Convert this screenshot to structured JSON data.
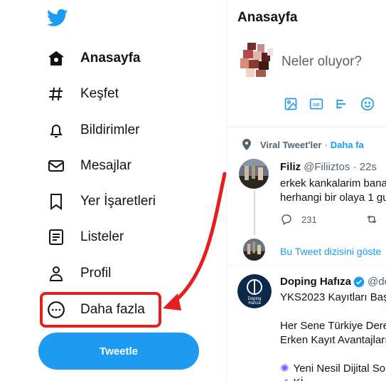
{
  "sidebar": {
    "items": [
      {
        "label": "Anasayfa",
        "icon": "home-icon",
        "active": true
      },
      {
        "label": "Keşfet",
        "icon": "hashtag-icon"
      },
      {
        "label": "Bildirimler",
        "icon": "bell-icon"
      },
      {
        "label": "Mesajlar",
        "icon": "mail-icon"
      },
      {
        "label": "Yer İşaretleri",
        "icon": "bookmark-icon"
      },
      {
        "label": "Listeler",
        "icon": "list-icon"
      },
      {
        "label": "Profil",
        "icon": "profile-icon"
      },
      {
        "label": "Daha fazla",
        "icon": "more-icon"
      }
    ],
    "tweet_button": "Tweetle"
  },
  "main": {
    "title": "Anasayfa",
    "compose": {
      "placeholder": "Neler oluyor?"
    },
    "context": {
      "label": "Viral Tweet'ler",
      "link": "Daha fa"
    },
    "tweet1": {
      "name": "Filiz",
      "handle": "@Filiiztos · 22s",
      "line1": "erkek kankalarim bana",
      "line2": "herhangi bir olaya 1 gu",
      "reply_count": "231",
      "show_thread": "Bu Tweet dizisini göste"
    },
    "tweet2": {
      "name": "Doping Hafıza",
      "handle": "@do",
      "line1": "YKS2023 Kayıtları Baş",
      "line2": "Her Sene Türkiye Dere",
      "line3": "Erken Kayıt Avantajları",
      "line4": "Yeni Nesil Dijital So",
      "line5": "Kİ",
      "avatar_text_1": "Doping",
      "avatar_text_2": "Hafıza"
    }
  },
  "colors": {
    "accent": "#1d9bf0",
    "highlight": "#e51e1e",
    "text": "#0f1419",
    "muted": "#536471"
  }
}
